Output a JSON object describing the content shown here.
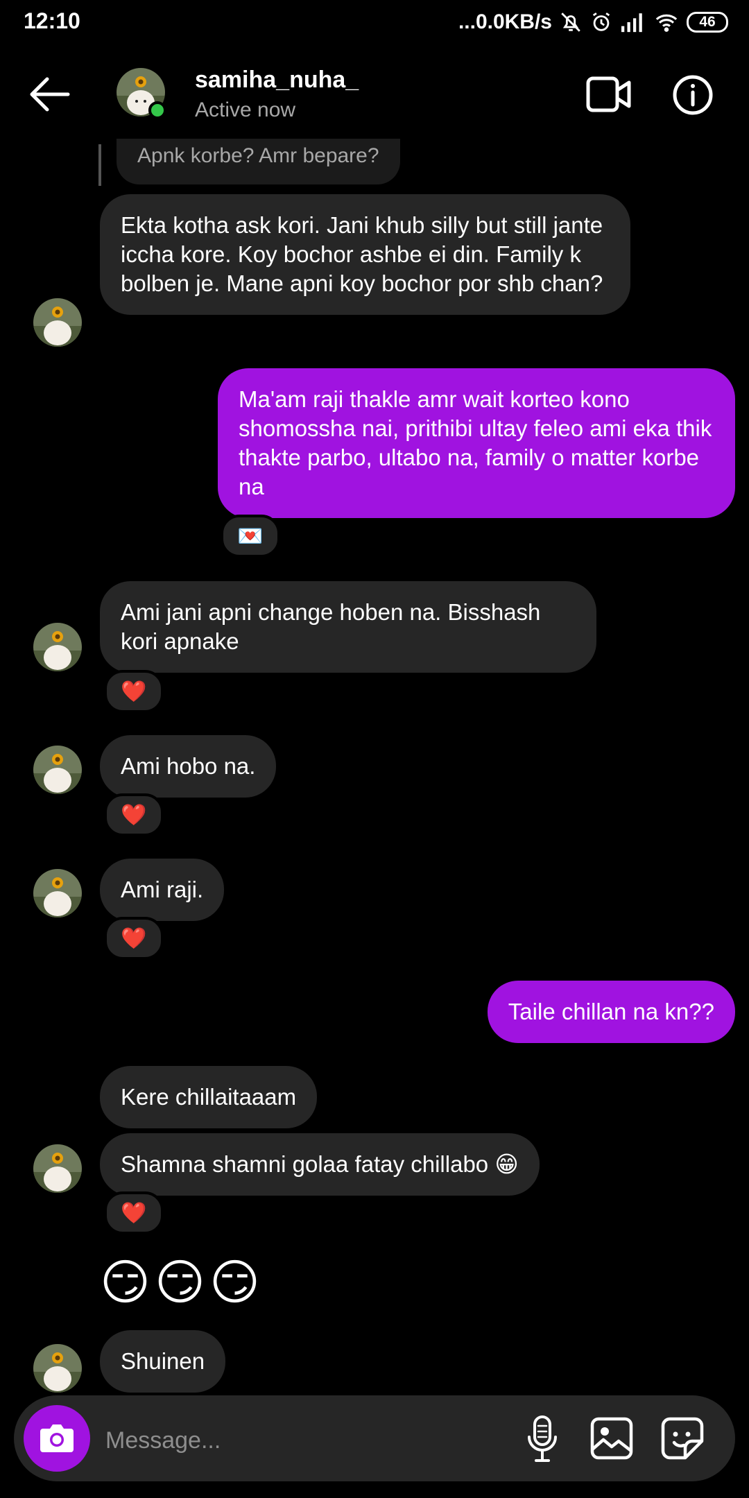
{
  "status_bar": {
    "time": "12:10",
    "net_speed": "...0.0KB/s",
    "battery": "46"
  },
  "header": {
    "username": "samiha_nuha_",
    "status": "Active now"
  },
  "reply_quote": "Apnk korbe? Amr bepare?",
  "messages": [
    {
      "from": "them",
      "text": "Ekta kotha ask kori. Jani khub silly but still jante iccha kore. Koy bochor ashbe ei din. Family k bolben je. Mane apni koy bochor por shb chan?"
    },
    {
      "from": "me",
      "text": "Ma'am raji thakle amr wait korteo kono shomossha nai, prithibi ultay feleo ami eka thik thakte parbo, ultabo na, family o matter korbe na",
      "reaction": "💌"
    },
    {
      "from": "them",
      "text": "Ami jani apni change hoben na.  Bisshash kori apnake",
      "reaction": "❤️"
    },
    {
      "from": "them",
      "text": "Ami hobo na.",
      "reaction": "❤️"
    },
    {
      "from": "them",
      "text": "Ami raji.",
      "reaction": "❤️"
    },
    {
      "from": "me",
      "text": "Taile chillan na kn??"
    },
    {
      "from": "them",
      "text": "Kere chillaitaaam"
    },
    {
      "from": "them",
      "text": "Shamna shamni golaa fatay chillabo 😁",
      "reaction": "❤️"
    },
    {
      "from": "them",
      "text": "😏😏😏"
    },
    {
      "from": "them",
      "text": "Shuinen"
    }
  ],
  "composer": {
    "placeholder": "Message..."
  },
  "colors": {
    "sent_bubble": "#a013e0",
    "received_bubble": "#262626",
    "online_dot": "#34c74a"
  },
  "icons": [
    "back-arrow-icon",
    "video-call-icon",
    "info-icon",
    "camera-icon",
    "microphone-icon",
    "gallery-icon",
    "sticker-icon"
  ]
}
